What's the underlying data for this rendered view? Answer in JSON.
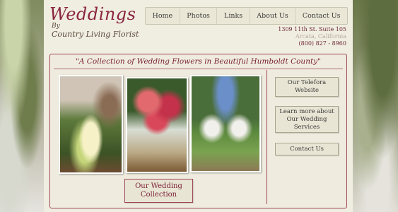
{
  "brand": {
    "title": "Weddings",
    "by": "By",
    "subtitle": "Country Living Florist"
  },
  "nav": {
    "items": [
      "Home",
      "Photos",
      "Links",
      "About Us",
      "Contact Us"
    ]
  },
  "address": {
    "street": "1309 11th St. Suite 105",
    "city": "Arcata, California",
    "phone": "(800) 827 - 8960"
  },
  "main": {
    "tagline": "\"A Collection of Wedding Flowers in Beautiful Humboldt County\"",
    "collection_button": "Our Wedding Collection"
  },
  "sidebar": {
    "telefora_button": "Our Telefora Website",
    "services_button": "Learn more about Our Wedding Services",
    "contact_button": "Contact Us"
  },
  "colors": {
    "accent": "#8a2540",
    "panel": "#f0ede1",
    "border": "#9f4456"
  }
}
